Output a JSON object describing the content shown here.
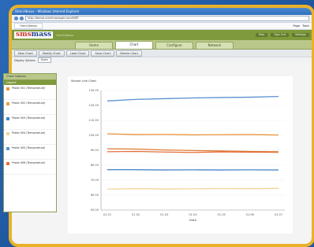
{
  "window": {
    "title": "Omni-Nexus - Windows Internet Explorer"
  },
  "browser": {
    "address": "http://demo.omnimanager.com/NSR",
    "tab_label": "Omni-Nexus",
    "menu": [
      "Page",
      "Tools"
    ]
  },
  "brand": {
    "logo_main": "sms",
    "logo_rest": "mass",
    "subtitle": "Omni-Nexus",
    "top_buttons": [
      "Help",
      "Sign Out",
      "Settings"
    ]
  },
  "nav": {
    "tabs": [
      "Home",
      "Chart",
      "Configure",
      "Network"
    ],
    "active": "Chart"
  },
  "actions": [
    "New Chart",
    "Modify Chart",
    "Load Chart",
    "Save Chart",
    "Delete Chart"
  ],
  "filter": {
    "label": "Display Options",
    "value": "Open"
  },
  "sidebar": {
    "header": "Chart Options",
    "subheader": "Legend",
    "items": [
      {
        "label": "Probe 001 (Temperature)",
        "color": "#e8933a"
      },
      {
        "label": "Probe 002 (Temperature)",
        "color": "#e8a24a"
      },
      {
        "label": "Probe 003 (Temperature)",
        "color": "#3f87cc"
      },
      {
        "label": "Probe 004 (Temperature)",
        "color": "#f1d49a"
      },
      {
        "label": "Probe 005 (Temperature)",
        "color": "#5b93cf"
      },
      {
        "label": "Probe 006 (Temperature)",
        "color": "#e46f3a"
      }
    ]
  },
  "chart_data": {
    "type": "line",
    "title": "Sensor Line Chart",
    "xlabel": "Date",
    "x": [
      "01.01",
      "01.02",
      "01.03",
      "01.04",
      "01.05",
      "01.06",
      "01.07"
    ],
    "y_ticks": [
      "130.00",
      "120.00",
      "110.00",
      "100.00",
      "90.00",
      "80.00",
      "70.00",
      "60.00",
      "50.00"
    ],
    "ylim": [
      50,
      130
    ],
    "series": [
      {
        "color": "#5b8fd0",
        "values": [
          123,
          124,
          124.5,
          125,
          125.3,
          125.5,
          126
        ]
      },
      {
        "color": "#e8933a",
        "values": [
          101,
          100.5,
          100.6,
          100.3,
          100.4,
          100.5,
          100.2
        ]
      },
      {
        "color": "#e07a32",
        "values": [
          91,
          90.8,
          90.2,
          89.8,
          89.5,
          89.2,
          89
        ]
      },
      {
        "color": "#e46f3a",
        "values": [
          89,
          89.2,
          88.8,
          88.5,
          88.9,
          88.7,
          88.6
        ]
      },
      {
        "color": "#4a86c9",
        "values": [
          77,
          77,
          76.8,
          76.9,
          76.8,
          76.9,
          76.8
        ]
      },
      {
        "color": "#f1d49a",
        "values": [
          64,
          64.3,
          64.1,
          64.2,
          64.4,
          64.3,
          64.5
        ]
      }
    ]
  }
}
